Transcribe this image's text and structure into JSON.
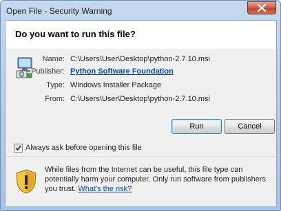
{
  "window": {
    "title": "Open File - Security Warning"
  },
  "dialog": {
    "question": "Do you want to run this file?",
    "details": [
      {
        "label": "Name:",
        "value": "C:\\Users\\User\\Desktop\\python-2.7.10.msi"
      },
      {
        "label": "Publisher:",
        "value": "Python Software Foundation"
      },
      {
        "label": "Type:",
        "value": "Windows Installer Package"
      },
      {
        "label": "From:",
        "value": "C:\\Users\\User\\Desktop\\python-2.7.10.msi"
      }
    ],
    "run_label": "Run",
    "cancel_label": "Cancel",
    "always_ask_label": "Always ask before opening this file",
    "always_ask_checked": true,
    "warning_text": "While files from the Internet can be useful, this file type can potentially harm your computer. Only run software from publishers you trust.",
    "warning_link": "What's the risk?"
  },
  "colors": {
    "titlebar": "#b9cfe9",
    "close_button": "#c4432b",
    "link": "#0645ad"
  },
  "icons": {
    "file": "windows-installer-icon",
    "warning": "security-shield-icon",
    "close": "close-icon",
    "check": "checkmark-icon"
  }
}
